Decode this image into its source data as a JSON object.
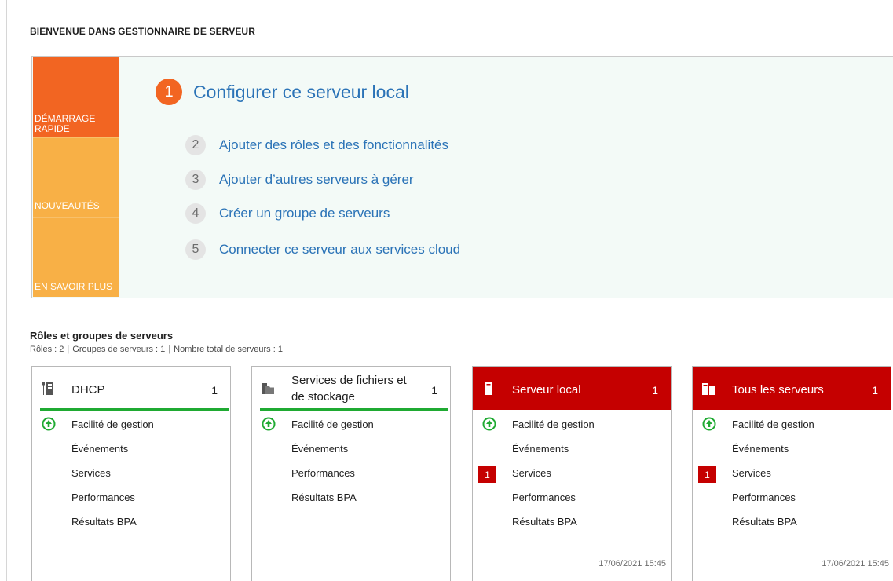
{
  "welcome": {
    "title": "BIENVENUE DANS GESTIONNAIRE DE SERVEUR"
  },
  "quickstart": {
    "tabs": {
      "demarrage": "DÉMARRAGE RAPIDE",
      "nouveautes": "NOUVEAUTÉS",
      "savoir": "EN SAVOIR PLUS"
    },
    "steps": [
      {
        "num": "1",
        "label": "Configurer ce serveur local"
      },
      {
        "num": "2",
        "label": "Ajouter des rôles et des fonctionnalités"
      },
      {
        "num": "3",
        "label": "Ajouter d’autres serveurs à gérer"
      },
      {
        "num": "4",
        "label": "Créer un groupe de serveurs"
      },
      {
        "num": "5",
        "label": "Connecter ce serveur aux services cloud"
      }
    ]
  },
  "roles": {
    "title": "Rôles et groupes de serveurs",
    "summary": {
      "roles": "Rôles : 2",
      "groups": "Groupes de serveurs : 1",
      "total": "Nombre total de serveurs : 1"
    }
  },
  "tiles": [
    {
      "name": "DHCP",
      "count": "1",
      "icon": "dhcp-icon",
      "items": [
        "Facilité de gestion",
        "Événements",
        "Services",
        "Performances",
        "Résultats BPA"
      ]
    },
    {
      "name_line1": "Services de fichiers et",
      "name_line2": "de stockage",
      "count": "1",
      "icon": "file-storage-icon",
      "items": [
        "Facilité de gestion",
        "Événements",
        "Performances",
        "Résultats BPA"
      ]
    },
    {
      "name": "Serveur local",
      "count": "1",
      "icon": "server-icon",
      "services_badge": "1",
      "timestamp": "17/06/2021 15:45",
      "items": [
        "Facilité de gestion",
        "Événements",
        "Services",
        "Performances",
        "Résultats BPA"
      ]
    },
    {
      "name": "Tous les serveurs",
      "count": "1",
      "icon": "servers-icon",
      "services_badge": "1",
      "timestamp": "17/06/2021 15:45",
      "items": [
        "Facilité de gestion",
        "Événements",
        "Services",
        "Performances",
        "Résultats BPA"
      ]
    }
  ],
  "colors": {
    "orange": "#f26522",
    "amber": "#f8b046",
    "link": "#2b73b7",
    "alert": "#c50000",
    "ok": "#1faa32"
  }
}
